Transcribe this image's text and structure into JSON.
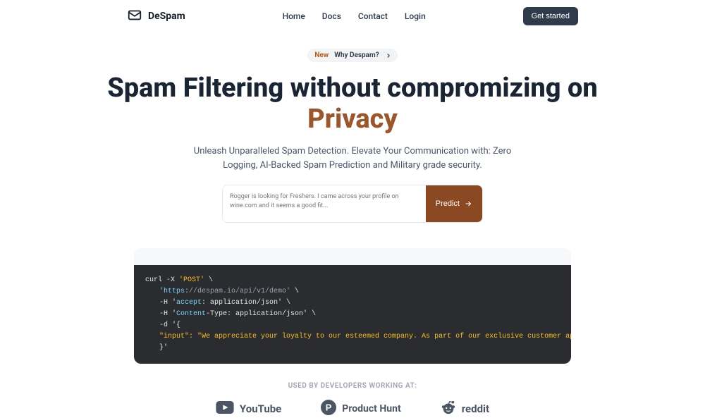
{
  "header": {
    "brand": "DeSpam",
    "nav": {
      "home": "Home",
      "docs": "Docs",
      "contact": "Contact",
      "login": "Login"
    },
    "cta": "Get started"
  },
  "hero": {
    "badge_new": "New",
    "badge_why": "Why Despam?",
    "title_line1": "Spam Filtering without compromizing on",
    "title_accent": "Privacy",
    "subtitle": "Unleash Unparalleled Spam Detection. Elevate Your Communication with: Zero Logging, AI-Backed Spam Prediction and Military grade security."
  },
  "predict": {
    "placeholder": "Rogger is looking for Freshers. I came across your profile on wine.com and it seems a good fit...",
    "button": "Predict"
  },
  "code": {
    "l1_pre": "curl -X ",
    "l1_post": "'POST'",
    "l1_bs": " \\",
    "l2_pre": "'https:",
    "l2_post": "//despam.io/api/v1/demo'",
    "l2_bs": " \\",
    "l3_pre": "-H '",
    "l3_mid": "accept",
    "l3_post": ": application/json'",
    "l3_bs": " \\",
    "l4_pre": "-H '",
    "l4_mid": "Content",
    "l4_post": "-Type: application/json'",
    "l4_bs": " \\",
    "l5": "-d '{",
    "l6": "\"input\": \"We appreciate your loyalty to our esteemed company. As part of our exclusive customer appreciation program, you have been selected to receive a con",
    "l7": "}'"
  },
  "usedby": "USED BY DEVELOPERS WORKING AT:",
  "logos": {
    "youtube": "YouTube",
    "producthunt": "Product Hunt",
    "reddit": "reddit"
  }
}
